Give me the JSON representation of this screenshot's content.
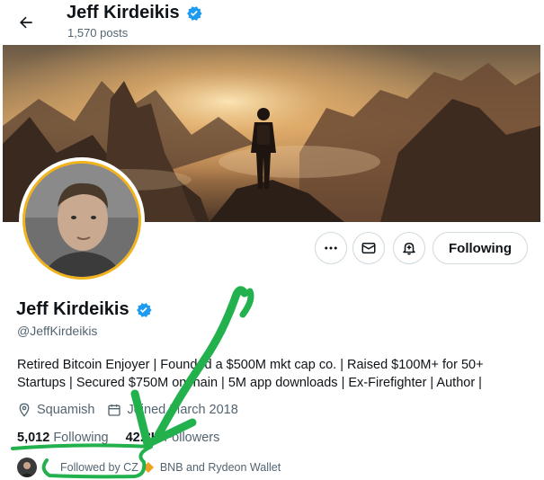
{
  "header": {
    "back_icon": "arrow-left-icon",
    "name": "Jeff Kirdeikis",
    "posts": "1,570 posts"
  },
  "profile": {
    "name": "Jeff Kirdeikis",
    "handle": "@JeffKirdeikis",
    "bio_line1": "Retired Bitcoin Enjoyer | Founded a $500M mkt cap co. | Raised $100M+ for 50+",
    "bio_line2": "Startups | Secured $750M onchain | 5M app downloads | Ex-Firefighter | Author |",
    "location": "Squamish",
    "joined": "Joined March 2018",
    "following_count": "5,012",
    "following_label": "Following",
    "followers_count": "42.8K",
    "followers_label": "Followers",
    "followed_by_prefix": "Followed by CZ",
    "followed_by_rest": "BNB and Rydeon Wallet"
  },
  "actions": {
    "more_icon": "more-icon",
    "message_icon": "mail-icon",
    "notify_icon": "bell-plus-icon",
    "follow_label": "Following"
  },
  "colors": {
    "verified": "#1d9bf0",
    "avatar_ring": "#f2b31a",
    "annotation": "#22b14c",
    "text_secondary": "#536471"
  }
}
